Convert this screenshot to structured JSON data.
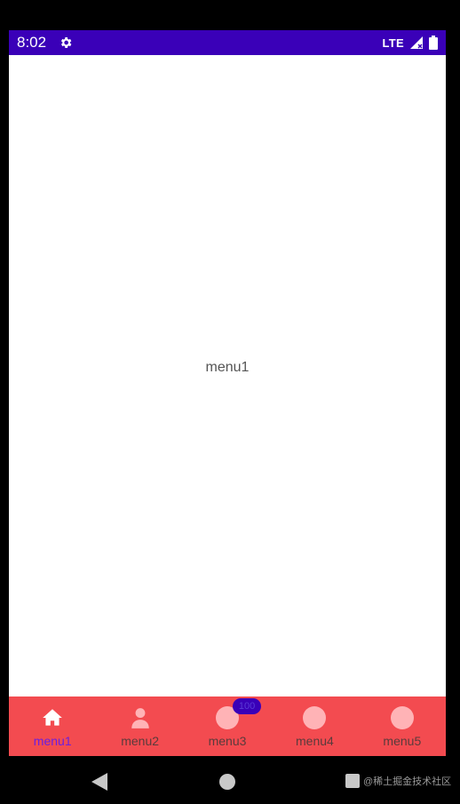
{
  "status_bar": {
    "time": "8:02",
    "network": "LTE",
    "bg_color": "#3a00b8"
  },
  "content": {
    "text": "menu1"
  },
  "bottom_nav": {
    "bg_color": "#f34b50",
    "items": [
      {
        "label": "menu1",
        "icon": "home-icon",
        "active": true
      },
      {
        "label": "menu2",
        "icon": "person-icon",
        "active": false
      },
      {
        "label": "menu3",
        "icon": "circle-icon",
        "active": false,
        "badge": "100"
      },
      {
        "label": "menu4",
        "icon": "circle-icon",
        "active": false
      },
      {
        "label": "menu5",
        "icon": "circle-icon",
        "active": false
      }
    ]
  },
  "system_nav": {
    "watermark": "@稀土掘金技术社区"
  }
}
